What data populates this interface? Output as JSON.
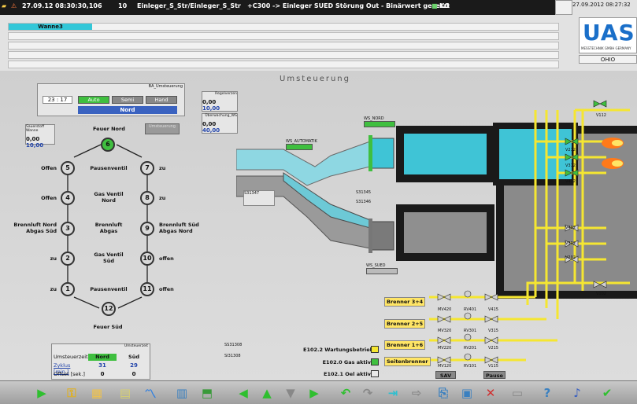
{
  "header": {
    "date": "27.09.12",
    "time": "08:30:30,106",
    "id": "10",
    "source": "Einleger_S_Str/Einleger_S_Str",
    "message": "+C300 -> Einleger SUED Störung Out - Binärwert gesetzt",
    "flag": "KG",
    "datetime_right": "27.09.2012 08:27:32",
    "row2_label": "Wanne3",
    "location": "OHIO"
  },
  "logo": {
    "text": "UAS",
    "subtitle": "MESSTECHNIK GMBH  GERMANY"
  },
  "page_title": "Umsteuerung",
  "control_panel": {
    "header": "BA_Umsteuerung",
    "time": "23 : 17",
    "modes": [
      "Auto",
      "Semi",
      "Hand"
    ],
    "status": "Nord"
  },
  "small_panels": {
    "wanne_title": "Sauerstoff Wanne",
    "wanne_v1": "0,00",
    "wanne_v2": "10,00",
    "p1_title": "Regelverzen",
    "p1_v1": "0,00",
    "p1_v2": "10,00",
    "p2_title": "Überwachung_WS",
    "p2_v1": "0,00",
    "p2_v2": "40,00",
    "umsteuer": "Umsteuerung"
  },
  "sequence": {
    "top_label": "Feuer Nord",
    "bottom_label": "Feuer Süd",
    "nodes": [
      "1",
      "2",
      "3",
      "4",
      "5",
      "6",
      "7",
      "8",
      "9",
      "10",
      "11",
      "12"
    ],
    "left": [
      "zu",
      "zu",
      "Brennluft Nord\nAbgas Süd",
      "Offen",
      "Offen"
    ],
    "right": [
      "zu",
      "zu",
      "Brennluft Süd\nAbgas Nord",
      "offen",
      "offen"
    ],
    "center": [
      "Pausenventil",
      "Gas Ventil\nNord",
      "Brennluft\nAbgas",
      "Gas Ventil\nSüd",
      "Pausenventil"
    ]
  },
  "cycle": {
    "header": "Umsteuerzeit",
    "col_a": "Umsteuerzeit",
    "col_b": "Nord",
    "col_c": "Süd",
    "row1_label": "Zyklus [min.]",
    "row1_b": "31",
    "row1_c": "29",
    "row2_label": "Offset [sek.]",
    "row2_b": "0",
    "row2_c": "0"
  },
  "plant": {
    "ws_nord": "WS_NORD",
    "ws_sued": "WS_SUED",
    "ws_auto": "WS_AUTOMATIK",
    "s31347": "S31347",
    "s31345": "S31345",
    "s31346": "S31346",
    "ss31308": "SS31308",
    "si31308": "SI31308",
    "valves": [
      "V112",
      "V212",
      "V312",
      "V412",
      "V402",
      "V302",
      "V202",
      "V102"
    ],
    "burners": [
      "Brenner 3+4",
      "Brenner 2+5",
      "Brenner 1+6",
      "Seitenbrenner"
    ],
    "burner_valves": [
      [
        "MV420",
        "RV401",
        "V415"
      ],
      [
        "MV320",
        "RV301",
        "V315"
      ],
      [
        "MV220",
        "RV201",
        "V215"
      ],
      [
        "MV120",
        "RV101",
        "V115"
      ]
    ],
    "legend": [
      "E102.2 Wartungsbetrieb",
      "E102.0 Gas aktiv",
      "E102.1 Oel aktiv"
    ],
    "btn_sav": "SAV",
    "btn_pause": "Pause"
  },
  "colors": {
    "accent": "#2ab5c8",
    "gas": "#f5e631",
    "green": "#3fbf3f",
    "logo": "#1a6fc9"
  },
  "toolbar_icons": [
    "play-icon",
    "key-icon",
    "folder-icon",
    "chart-icon",
    "trend-icon",
    "report-icon",
    "export-icon",
    "arrow-left-icon",
    "arrow-up-icon",
    "arrow-down-icon",
    "arrow-right-icon",
    "undo-icon",
    "redo-icon",
    "import-icon",
    "forward-icon",
    "copy-icon",
    "save-icon",
    "delete-icon",
    "print-icon",
    "help-icon",
    "sound-icon",
    "ack-icon"
  ]
}
